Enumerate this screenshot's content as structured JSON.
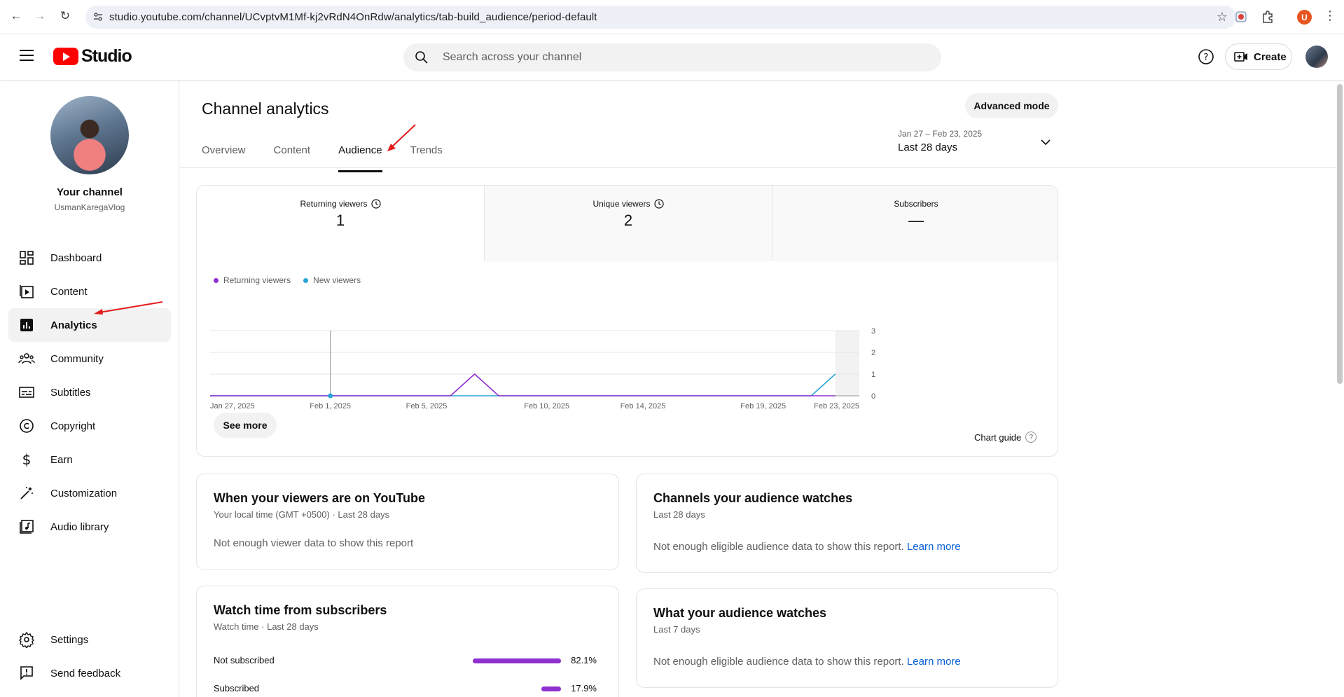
{
  "browser": {
    "url": "studio.youtube.com/channel/UCvptvM1Mf-kj2vRdN4OnRdw/analytics/tab-build_audience/period-default",
    "profile_initial": "U"
  },
  "header": {
    "logo_text": "Studio",
    "search_placeholder": "Search across your channel",
    "create_label": "Create"
  },
  "sidebar": {
    "channel_name": "Your channel",
    "channel_handle": "UsmanKaregaVlog",
    "items": [
      {
        "label": "Dashboard",
        "icon": "dashboard-icon"
      },
      {
        "label": "Content",
        "icon": "content-icon"
      },
      {
        "label": "Analytics",
        "icon": "analytics-icon",
        "active": true
      },
      {
        "label": "Community",
        "icon": "community-icon"
      },
      {
        "label": "Subtitles",
        "icon": "subtitles-icon"
      },
      {
        "label": "Copyright",
        "icon": "copyright-icon"
      },
      {
        "label": "Earn",
        "icon": "earn-icon"
      },
      {
        "label": "Customization",
        "icon": "customization-icon"
      },
      {
        "label": "Audio library",
        "icon": "audio-library-icon"
      }
    ],
    "bottom_items": [
      {
        "label": "Settings",
        "icon": "gear-icon"
      },
      {
        "label": "Send feedback",
        "icon": "feedback-icon"
      }
    ]
  },
  "main": {
    "title": "Channel analytics",
    "advanced_mode": "Advanced mode",
    "tabs": [
      {
        "label": "Overview"
      },
      {
        "label": "Content"
      },
      {
        "label": "Audience",
        "active": true
      },
      {
        "label": "Trends"
      }
    ],
    "date_range": {
      "dates": "Jan 27 – Feb 23, 2025",
      "label": "Last 28 days"
    },
    "metrics": [
      {
        "label": "Returning viewers",
        "value": "1"
      },
      {
        "label": "Unique viewers",
        "value": "2"
      },
      {
        "label": "Subscribers",
        "value": "—"
      }
    ],
    "see_more": "See more",
    "chart_guide": "Chart guide"
  },
  "chart_data": {
    "type": "line",
    "x_tick_labels": [
      "Jan 27, 2025",
      "Feb 1, 2025",
      "Feb 5, 2025",
      "Feb 10, 2025",
      "Feb 14, 2025",
      "Feb 19, 2025",
      "Feb 23, 2025"
    ],
    "x_tick_positions": [
      0,
      5,
      9,
      14,
      18,
      23,
      27
    ],
    "ylim": [
      0,
      3
    ],
    "y_ticks": [
      "3",
      "2",
      "1",
      "0"
    ],
    "legend_placement": "top-left",
    "grid": true,
    "series": [
      {
        "name": "Returning viewers",
        "color": "#8e2fcf",
        "values": [
          0,
          0,
          0,
          0,
          0,
          0,
          0,
          0,
          0,
          0,
          0,
          0,
          0,
          0,
          0,
          0,
          0,
          0,
          0,
          0,
          0,
          0,
          0,
          0,
          0,
          0,
          0,
          0
        ]
      },
      {
        "name": "New viewers",
        "color": "#2ba4d6",
        "values": [
          0,
          0,
          0,
          0,
          0,
          0,
          0,
          0,
          0,
          0,
          0,
          0,
          0,
          0,
          0,
          0,
          0,
          0,
          0,
          0,
          0,
          0,
          0,
          0,
          0,
          0,
          0,
          1
        ]
      }
    ],
    "combined_points": {
      "returning_peak_index": 11,
      "returning_peak_value": 1
    },
    "highlight_index": 5,
    "partial_period_start_index": 26
  },
  "reports": {
    "viewers_time": {
      "title": "When your viewers are on YouTube",
      "sub": "Your local time (GMT +0500) · Last 28 days",
      "message": "Not enough viewer data to show this report"
    },
    "channels_watch": {
      "title": "Channels your audience watches",
      "sub": "Last 28 days",
      "message": "Not enough eligible audience data to show this report.",
      "link": "Learn more"
    },
    "watch_subs": {
      "title": "Watch time from subscribers",
      "sub": "Watch time · Last 28 days",
      "rows": [
        {
          "label": "Not subscribed",
          "pct": "82.1%",
          "value": 82.1
        },
        {
          "label": "Subscribed",
          "pct": "17.9%",
          "value": 17.9
        }
      ]
    },
    "audience_watches": {
      "title": "What your audience watches",
      "sub": "Last 7 days",
      "message": "Not enough eligible audience data to show this report.",
      "link": "Learn more"
    }
  }
}
